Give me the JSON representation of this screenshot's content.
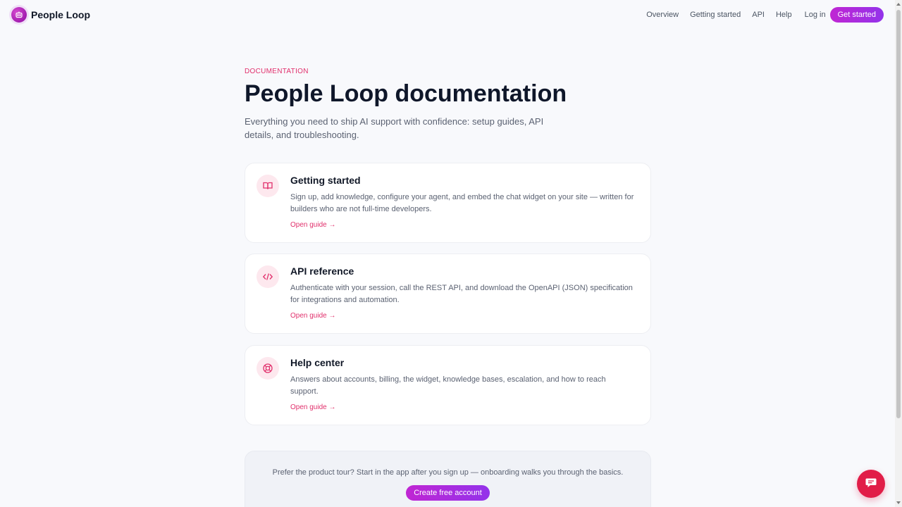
{
  "header": {
    "brand": "People Loop",
    "nav": [
      "Overview",
      "Getting started",
      "API",
      "Help"
    ],
    "login": "Log in",
    "cta": "Get started"
  },
  "main": {
    "eyebrow": "DOCUMENTATION",
    "title": "People Loop documentation",
    "subtitle": "Everything you need to ship AI support with confidence: setup guides, API details, and troubleshooting."
  },
  "cards": [
    {
      "icon": "book-icon",
      "title": "Getting started",
      "description": "Sign up, add knowledge, configure your agent, and embed the chat widget on your site — written for builders who are not full-time developers.",
      "link": "Open guide →"
    },
    {
      "icon": "code-icon",
      "title": "API reference",
      "description": "Authenticate with your session, call the REST API, and download the OpenAPI (JSON) specification for integrations and automation.",
      "link": "Open guide →"
    },
    {
      "icon": "lifebuoy-icon",
      "title": "Help center",
      "description": "Answers about accounts, billing, the widget, knowledge bases, escalation, and how to reach support.",
      "link": "Open guide →"
    }
  ],
  "cta": {
    "text": "Prefer the product tour? Start in the app after you sign up — onboarding walks you through the basics.",
    "button": "Create free account"
  },
  "colors": {
    "accent": "#e1306c",
    "brand": "#c026d3",
    "chat_fab": "#e11d48"
  }
}
